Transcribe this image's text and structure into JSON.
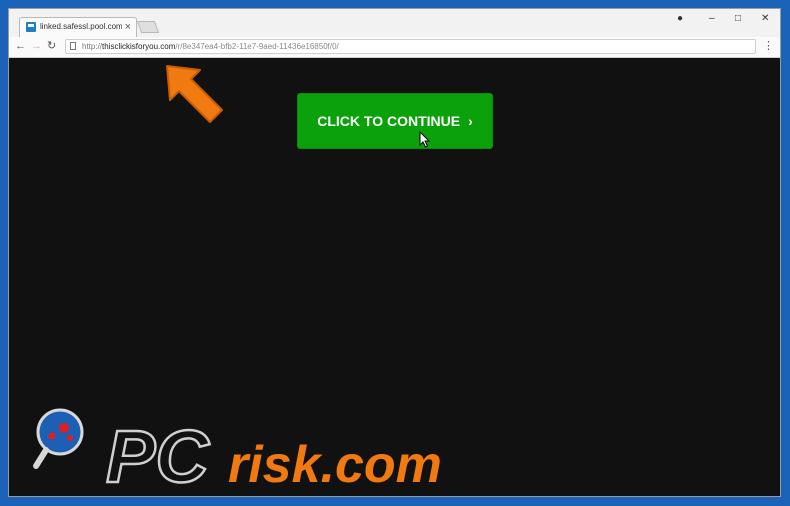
{
  "browser": {
    "tab": {
      "title": "linked.safessl.pool.com/..."
    },
    "window_controls": {
      "profile": "●",
      "minimize": "–",
      "maximize": "□",
      "close": "✕"
    },
    "toolbar": {
      "back": "←",
      "forward": "→",
      "reload": "↻",
      "menu": "⋮"
    },
    "address": {
      "scheme": "http://",
      "host": "thisclickisforyou.com",
      "path": "/r/8e347ea4-bfb2-11e7-9aed-11436e16850f/0/"
    }
  },
  "page": {
    "cta_label": "CLICK TO CONTINUE",
    "cta_arrow": "›"
  },
  "watermark": {
    "text_pc": "PC",
    "text_risk": "risk.com"
  },
  "colors": {
    "background_frame": "#1a63b8",
    "page_bg": "#111111",
    "cta_green": "#0aa10a",
    "arrow_orange": "#f07a10"
  },
  "icons": {
    "tab_favicon": "site-favicon",
    "address_page": "page-icon",
    "annotation": "orange-pointer-arrow",
    "cursor": "mouse-pointer-icon"
  }
}
